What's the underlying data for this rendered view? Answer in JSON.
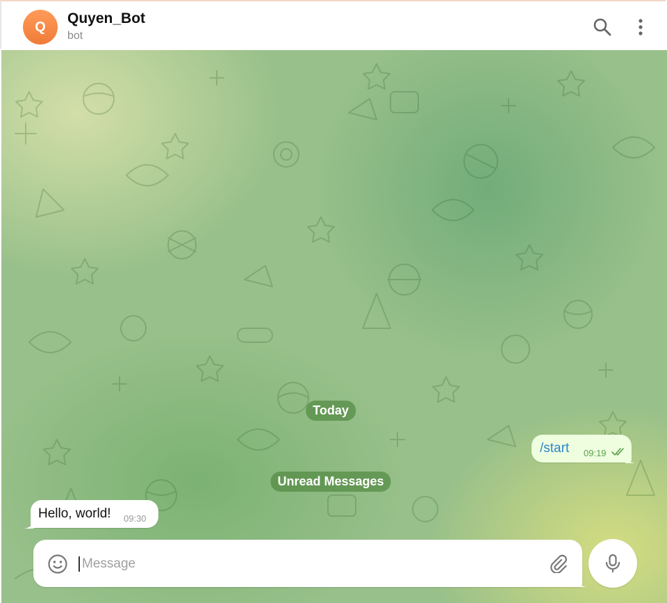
{
  "header": {
    "avatar_letter": "Q",
    "title": "Quyen_Bot",
    "subtitle": "bot",
    "icons": [
      "search-icon",
      "more-vertical-icon"
    ]
  },
  "chat": {
    "date_separator": "Today",
    "unread_separator": "Unread Messages",
    "messages": [
      {
        "direction": "outgoing",
        "text": "/start",
        "time": "09:19",
        "status": "read"
      },
      {
        "direction": "incoming",
        "text": "Hello, world!",
        "time": "09:30"
      }
    ]
  },
  "composer": {
    "placeholder": "Message",
    "value": "",
    "icons": [
      "emoji-icon",
      "attach-icon",
      "microphone-icon"
    ]
  },
  "colors": {
    "avatar": "#f28543",
    "outgoing_bubble": "#eefedf",
    "incoming_bubble": "#ffffff",
    "link": "#2c86cc",
    "read_ticks": "#5aa14b"
  }
}
